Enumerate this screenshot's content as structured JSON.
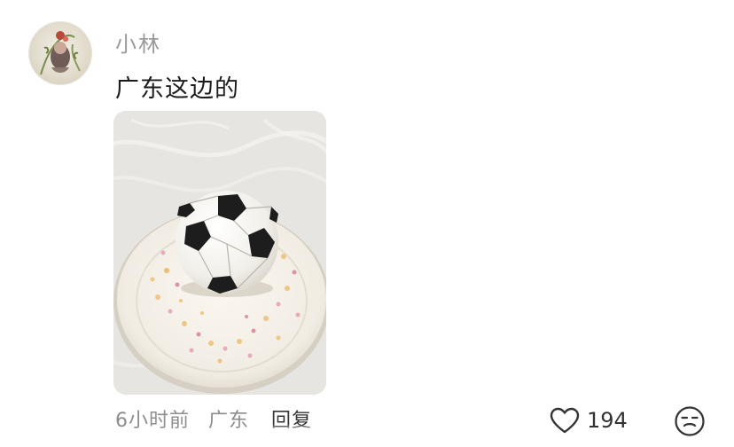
{
  "comment": {
    "username": "小林",
    "text": "广东这边的",
    "time": "6小时前",
    "location": "广东",
    "reply_label": "回复",
    "like_count": "194"
  },
  "icons": {
    "like": "heart-outline-icon",
    "emoji": "emoji-face-icon"
  },
  "colors": {
    "username": "#9a9a9a",
    "text": "#1c1c1c",
    "meta": "#8d8d8d"
  }
}
